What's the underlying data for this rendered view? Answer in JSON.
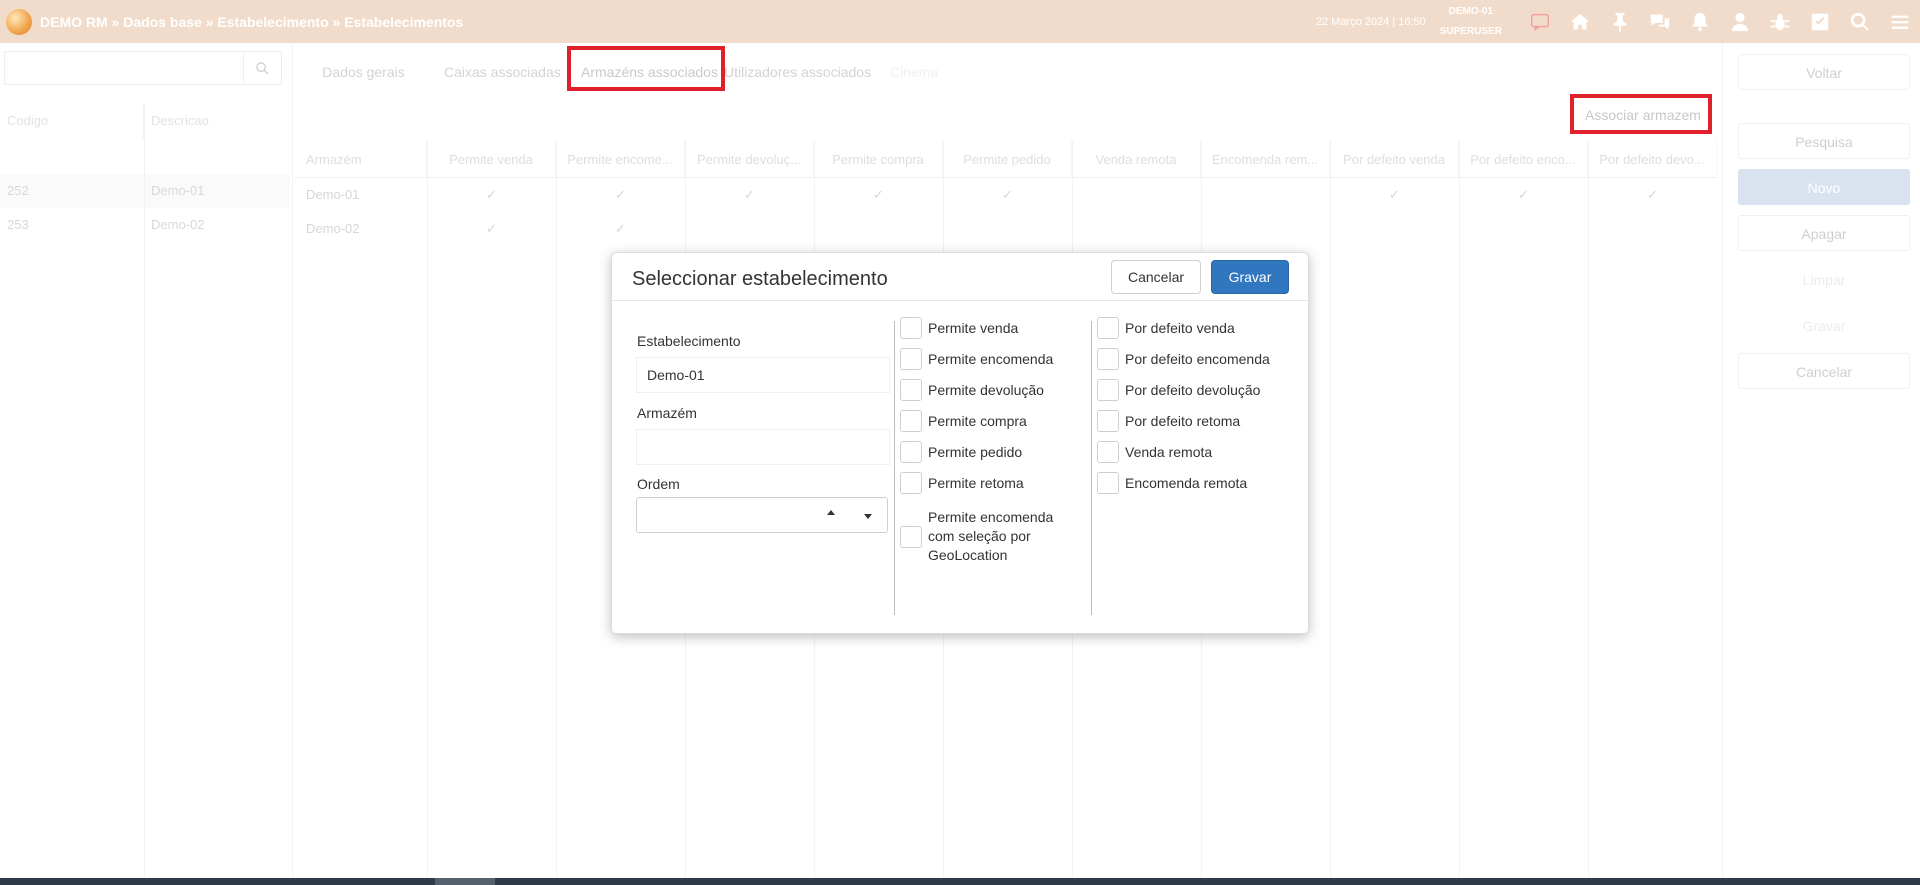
{
  "header": {
    "breadcrumb": "DEMO RM » Dados base » Estabelecimento » Estabelecimentos",
    "datetime": "22 Março 2024 | 16:50",
    "user_code": "DEMO-01",
    "user_role": "SUPERUSER",
    "icons": [
      "chat-alert-icon",
      "home-icon",
      "pin-icon",
      "comments-icon",
      "bell-icon",
      "user-icon",
      "bug-icon",
      "check-square-icon",
      "search-icon",
      "menu-icon"
    ]
  },
  "left_panel": {
    "search_placeholder": "",
    "columns": [
      "Codigo",
      "Descricao"
    ],
    "rows": [
      {
        "code": "252",
        "desc": "Demo-01"
      },
      {
        "code": "253",
        "desc": "Demo-02"
      }
    ]
  },
  "tabs": [
    "Dados gerais",
    "Caixas associadas",
    "Armazéns associados",
    "Utilizadores associados",
    "Cinema"
  ],
  "associate_button": "Associar armazem",
  "grid": {
    "columns": [
      "Armazém",
      "Permite venda",
      "Permite encome...",
      "Permite devoluç...",
      "Permite compra",
      "Permite pedido",
      "Venda remota",
      "Encomenda rem...",
      "Por defeito venda",
      "Por defeito enco...",
      "Por defeito devo..."
    ],
    "rows": [
      {
        "name": "Demo-01",
        "checks": [
          true,
          true,
          true,
          true,
          true,
          false,
          false,
          true,
          true,
          true
        ]
      },
      {
        "name": "Demo-02",
        "checks": [
          true,
          true,
          false,
          false,
          false,
          false,
          false,
          false,
          false,
          false
        ]
      }
    ],
    "check_glyph": "✓"
  },
  "right_panel": {
    "voltar": "Voltar",
    "pesquisa": "Pesquisa",
    "novo": "Novo",
    "apagar": "Apagar",
    "limpar": "Limpar",
    "gravar": "Gravar",
    "cancelar": "Cancelar"
  },
  "modal": {
    "title": "Seleccionar estabelecimento",
    "cancel": "Cancelar",
    "save": "Gravar",
    "estabelecimento_label": "Estabelecimento",
    "estabelecimento_value": "Demo-01",
    "armazem_label": "Armazém",
    "armazem_value": "",
    "ordem_label": "Ordem",
    "checks_col1": [
      "Permite venda",
      "Permite encomenda",
      "Permite devolução",
      "Permite compra",
      "Permite pedido",
      "Permite retoma",
      "Permite encomenda com seleção por GeoLocation"
    ],
    "checks_col2": [
      "Por defeito venda",
      "Por defeito encomenda",
      "Por defeito devolução",
      "Por defeito retoma",
      "Venda remota",
      "Encomenda remota"
    ]
  },
  "colors": {
    "header_bg": "#f1dccb",
    "primary": "#3177bf",
    "highlight": "#e0202a"
  }
}
